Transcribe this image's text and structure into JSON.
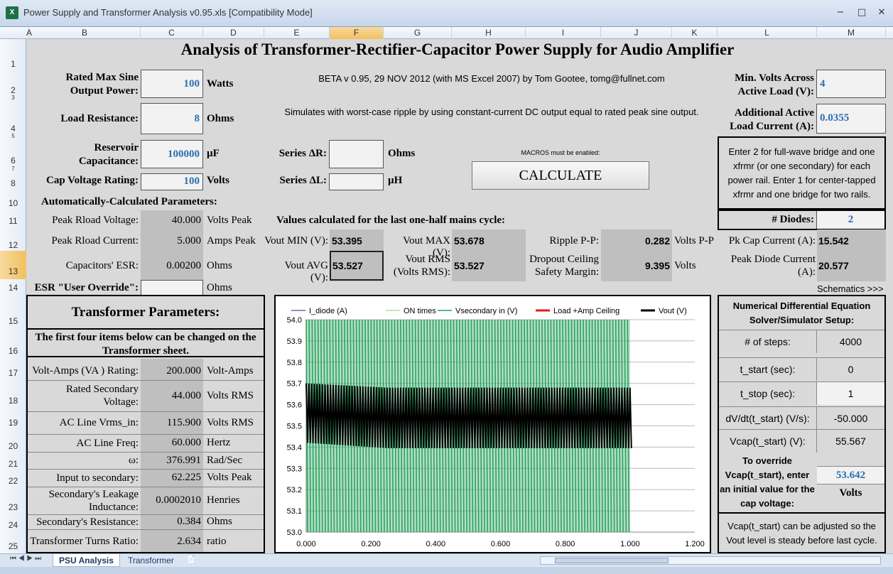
{
  "window": {
    "title": "Power Supply and Transformer Analysis v0.95.xls  [Compatibility Mode]",
    "app_icon": "excel-icon",
    "controls": [
      "minimize",
      "maximize",
      "close"
    ]
  },
  "columns": [
    "A",
    "B",
    "C",
    "D",
    "E",
    "F",
    "G",
    "H",
    "I",
    "J",
    "K",
    "L",
    "M"
  ],
  "rows": [
    "1",
    "2",
    "3",
    "4",
    "5",
    "6",
    "7",
    "8",
    "10",
    "11",
    "12",
    "13",
    "14",
    "15",
    "16",
    "17",
    "18",
    "19",
    "20",
    "21",
    "22",
    "23",
    "24",
    "25"
  ],
  "sheet": {
    "heading": "Analysis of Transformer-Rectifier-Capacitor Power Supply for Audio Amplifier",
    "beta_note": "BETA v 0.95, 29 NOV 2012 (with MS Excel 2007) by Tom Gootee, tomg@fullnet.com",
    "sim_note": "Simulates with worst-case ripple by using constant-current DC output equal to rated peak sine output.",
    "macro_note": "MACROS must be enabled:",
    "calculate_label": "CALCULATE",
    "inputs": {
      "rated_power_label": "Rated Max Sine Output Power:",
      "rated_power_value": "100",
      "rated_power_unit": "Watts",
      "load_res_label": "Load Resistance:",
      "load_res_value": "8",
      "load_res_unit": "Ohms",
      "reservoir_label": "Reservoir Capacitance:",
      "reservoir_value": "100000",
      "reservoir_unit": "µF",
      "cap_voltage_label": "Cap Voltage Rating:",
      "cap_voltage_value": "100",
      "cap_voltage_unit": "Volts",
      "series_r_label": "Series ΔR:",
      "series_r_value": "",
      "series_r_unit": "Ohms",
      "series_l_label": "Series ΔL:",
      "series_l_value": "",
      "series_l_unit": "µH",
      "min_volts_label": "Min. Volts Across Active Load (V):",
      "min_volts_value": "4",
      "add_current_label": "Additional Active Load Current  (A):",
      "add_current_value": "0.0355",
      "diodes_note": "Enter 2 for full-wave bridge and one xfrmr (or one secondary) for each power rail. Enter 1 for center-tapped xfrmr and one bridge for two rails.",
      "diodes_label": "# Diodes:",
      "diodes_value": "2"
    },
    "auto": {
      "heading": "Automatically-Calculated Parameters:",
      "peak_v_label": "Peak Rload Voltage:",
      "peak_v_value": "40.000",
      "peak_v_unit": "Volts Peak",
      "peak_i_label": "Peak Rload Current:",
      "peak_i_value": "5.000",
      "peak_i_unit": "Amps Peak",
      "esr_label": "Capacitors' ESR:",
      "esr_value": "0.00200",
      "esr_unit": "Ohms",
      "esr_override_label": "ESR \"User Override\":",
      "esr_override_value": "",
      "esr_override_unit": "Ohms"
    },
    "last_cycle": {
      "heading": "Values calculated for the last one-half mains cycle:",
      "vout_min_label": "Vout MIN (V):",
      "vout_min_value": "53.395",
      "vout_max_label": "Vout MAX (V):",
      "vout_max_value": "53.678",
      "ripple_label": "Ripple P-P:",
      "ripple_value": "0.282",
      "ripple_unit": "Volts P-P",
      "pk_cap_label": "Pk Cap Current (A):",
      "pk_cap_value": "15.542",
      "vout_avg_label": "Vout AVG (V):",
      "vout_avg_value": "53.527",
      "vout_rms_label": "Vout RMS (Volts RMS):",
      "vout_rms_value": "53.527",
      "dropout_label": "Dropout Ceiling Safety Margin:",
      "dropout_value": "9.395",
      "dropout_unit": "Volts",
      "pk_diode_label": "Peak Diode Current (A):",
      "pk_diode_value": "20.577"
    },
    "schematics_link": "Schematics >>>",
    "transformer": {
      "heading": "Transformer Parameters:",
      "note": "The first four items below can be changed  on the Transformer sheet.",
      "rows": [
        {
          "label": "Volt-Amps (VA ) Rating:",
          "value": "200.000",
          "unit": "Volt-Amps"
        },
        {
          "label": "Rated Secondary Voltage:",
          "value": "44.000",
          "unit": "Volts RMS"
        },
        {
          "label": "AC Line Vrms_in:",
          "value": "115.900",
          "unit": "Volts RMS"
        },
        {
          "label": "AC Line Freq:",
          "value": "60.000",
          "unit": "Hertz"
        },
        {
          "label": "ω:",
          "value": "376.991",
          "unit": "Rad/Sec"
        },
        {
          "label": "Input to secondary:",
          "value": "62.225",
          "unit": "Volts Peak"
        },
        {
          "label": "Secondary's Leakage Inductance:",
          "value": "0.0002010",
          "unit": "Henries"
        },
        {
          "label": "Secondary's Resistance:",
          "value": "0.384",
          "unit": "Ohms"
        },
        {
          "label": "Transformer Turns Ratio:",
          "value": "2.634",
          "unit": "ratio"
        }
      ]
    },
    "solver": {
      "heading": "Numerical Differential Equation Solver/Simulator Setup:",
      "rows": [
        {
          "label": "# of steps:",
          "value": "4000"
        },
        {
          "label": "t_start (sec):",
          "value": "0"
        },
        {
          "label": "t_stop (sec):",
          "value": "1"
        },
        {
          "label": "dV/dt(t_start) (V/s):",
          "value": "-50.000"
        },
        {
          "label": "Vcap(t_start) (V):",
          "value": "55.567"
        }
      ],
      "override_label": "To override Vcap(t_start), enter an initial value for the cap voltage:",
      "override_value": "53.642",
      "override_unit": "Volts",
      "footer_note": "Vcap(t_start) can be adjusted so the Vout level is steady before last cycle."
    }
  },
  "chart_data": {
    "type": "line",
    "legend_position": "top",
    "series": [
      {
        "name": "I_diode (A)",
        "color": "#8064a2"
      },
      {
        "name": "ON times",
        "color": "#c3d69b"
      },
      {
        "name": "Vsecondary in (V)",
        "color": "#2ca25f"
      },
      {
        "name": "Load +Amp Ceiling",
        "color": "#e41a1c"
      },
      {
        "name": "Vout (V)",
        "color": "#000000"
      }
    ],
    "xlim": [
      0.0,
      1.2
    ],
    "ylim": [
      53.0,
      54.0
    ],
    "x_ticks": [
      "0.000",
      "0.200",
      "0.400",
      "0.600",
      "0.800",
      "1.000",
      "1.200"
    ],
    "y_ticks": [
      "54.0",
      "53.9",
      "53.8",
      "53.7",
      "53.6",
      "53.5",
      "53.4",
      "53.3",
      "53.2",
      "53.1",
      "53.0"
    ],
    "vout_start_max": 53.7,
    "vout_start_min": 53.42,
    "vout_steady_max": 53.68,
    "vout_steady_min": 53.395,
    "sim_end": 1.0,
    "grid": true
  },
  "tabs": {
    "active": "PSU Analysis",
    "other": "Transformer"
  },
  "colors": {
    "input_blue": "#2a6fb0",
    "cell_gray": "#bfbfbf",
    "sheet_bg": "#d9d9d9"
  }
}
